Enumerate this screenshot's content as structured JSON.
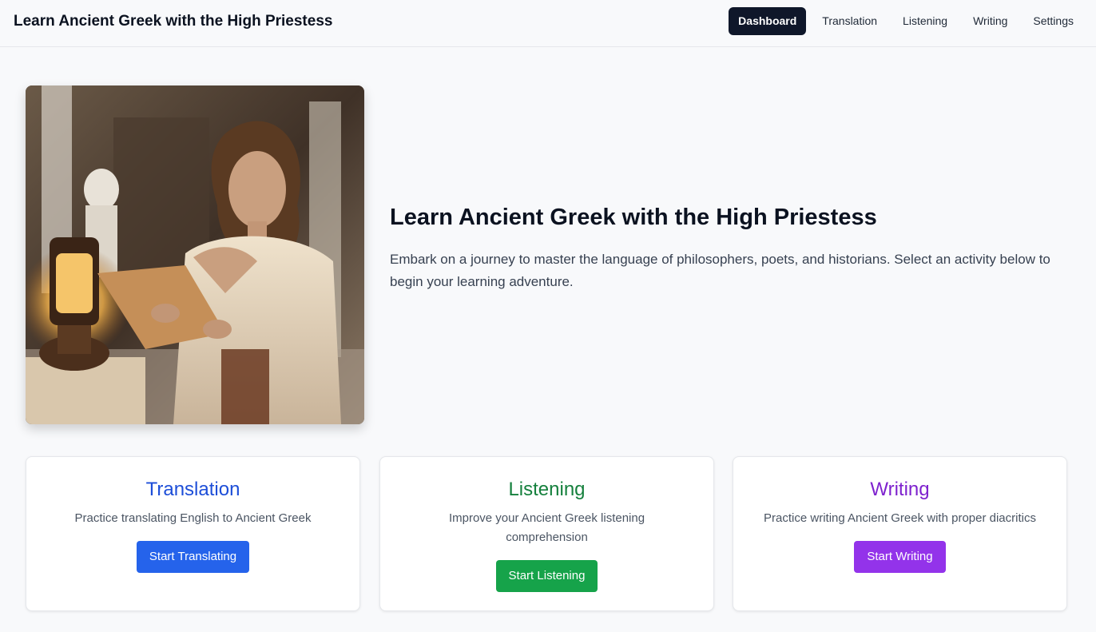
{
  "header": {
    "title": "Learn Ancient Greek with the High Priestess",
    "nav": [
      {
        "label": "Dashboard",
        "active": true
      },
      {
        "label": "Translation",
        "active": false
      },
      {
        "label": "Listening",
        "active": false
      },
      {
        "label": "Writing",
        "active": false
      },
      {
        "label": "Settings",
        "active": false
      }
    ]
  },
  "hero": {
    "title": "Learn Ancient Greek with the High Priestess",
    "description": "Embark on a journey to master the language of philosophers, poets, and historians. Select an activity below to begin your learning adventure.",
    "image": "priestess-with-scroll-and-lantern"
  },
  "cards": [
    {
      "title": "Translation",
      "description": "Practice translating English to Ancient Greek",
      "button": "Start Translating",
      "color": "#1d4ed8",
      "button_color": "#2563eb"
    },
    {
      "title": "Listening",
      "description": "Improve your Ancient Greek listening comprehension",
      "button": "Start Listening",
      "color": "#15803d",
      "button_color": "#16a34a"
    },
    {
      "title": "Writing",
      "description": "Practice writing Ancient Greek with proper diacritics",
      "button": "Start Writing",
      "color": "#7e22ce",
      "button_color": "#9333ea"
    }
  ]
}
